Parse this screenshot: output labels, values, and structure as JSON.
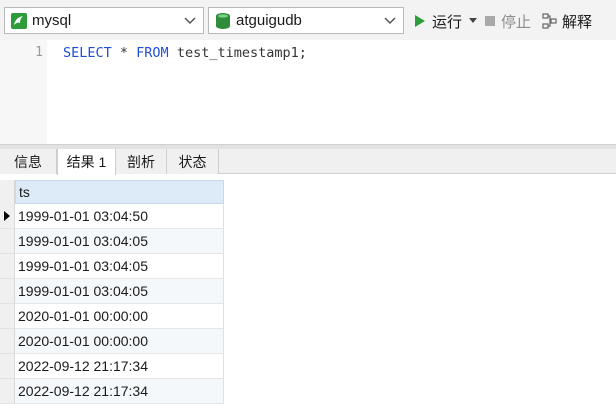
{
  "toolbar": {
    "connection": {
      "value": "mysql",
      "icon": "mysql-dolphin-icon"
    },
    "database": {
      "value": "atguigudb",
      "icon": "database-icon"
    },
    "run_label": "运行",
    "stop_label": "停止",
    "explain_label": "解释"
  },
  "editor": {
    "line_number": "1",
    "code": {
      "kw1": "SELECT",
      "star": " * ",
      "kw2": "FROM",
      "rest": " test_timestamp1;"
    }
  },
  "tabs": [
    "信息",
    "结果 1",
    "剖析",
    "状态"
  ],
  "active_tab": "结果 1",
  "grid": {
    "columns": [
      "ts"
    ],
    "rows": [
      "1999-01-01 03:04:50",
      "1999-01-01 03:04:05",
      "1999-01-01 03:04:05",
      "1999-01-01 03:04:05",
      "2020-01-01 00:00:00",
      "2020-01-01 00:00:00",
      "2022-09-12 21:17:34",
      "2022-09-12 21:17:34"
    ],
    "current_row_indicator": "row-pointer-icon"
  },
  "colors": {
    "keyword": "#1f4fd6",
    "run_icon": "#2e9c3a",
    "header_bg": "#dcebf7",
    "db_icon": "#2f8c3b"
  }
}
